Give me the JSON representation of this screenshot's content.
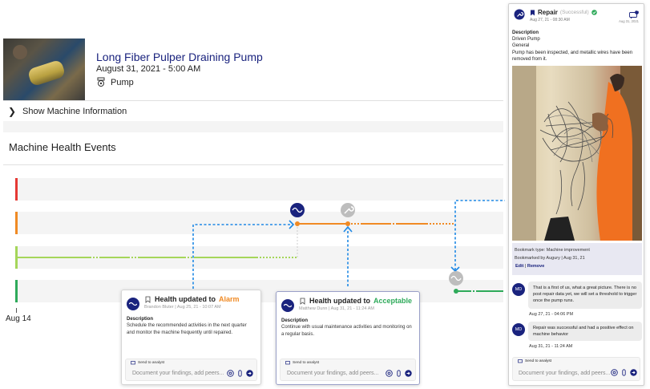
{
  "machine": {
    "name": "Long Fiber Pulper Draining Pump",
    "datetime": "August 31, 2021 - 5:00 AM",
    "type": "Pump"
  },
  "info_toggle": {
    "label": "Show Machine Information",
    "icon": "chevron-right-icon"
  },
  "section_title": "Machine Health Events",
  "axis": {
    "label": "Aug 14"
  },
  "lanes": [
    {
      "color": "#e53935"
    },
    {
      "color": "#f08a24"
    },
    {
      "color": "#a5d65a"
    },
    {
      "color": "#2eaa5a"
    }
  ],
  "cards": {
    "alarm": {
      "prefix": "Health updated to",
      "status": "Alarm",
      "meta": "Brandon Bluter | Aug 25, 21 - 10:07 AM",
      "desc_label": "Description",
      "desc": "Schedule the recommended activities in the next quarter and monitor the machine frequently until repaired.",
      "send_label": "Send to analyst",
      "placeholder": "Document your findings, add peers..."
    },
    "acceptable": {
      "prefix": "Health updated to",
      "status": "Acceptable",
      "meta": "Matthew Dunn | Aug 31, 21 - 11:24 AM",
      "desc_label": "Description",
      "desc": "Continue with usual maintenance activities and monitoring on a regular basis.",
      "send_label": "Send to analyst",
      "placeholder": "Document your findings, add peers..."
    }
  },
  "repair_panel": {
    "title": "Repair",
    "status": "(Successful)",
    "date": "Aug 27, 21 - 08:30 AM",
    "msg_badge": "1",
    "msg_date": "Aug 31, 2021",
    "desc_label": "Description",
    "desc_lines": [
      "Driven Pump",
      "General",
      "Pump has been inspected, and metallic wires have been removed from it."
    ],
    "bookmark_type": "Bookmark type: Machine improvement",
    "bookmarked_by": "Bookmarked by Augury | Aug 31, 21",
    "edit_label": "Edit",
    "remove_label": "Remove",
    "messages": [
      {
        "avatar": "MD",
        "text": "That is a first of us, what a great picture. There is no post repair data yet, we will set a threshold to trigger once the pump runs.",
        "time": "Aug 27, 21 - 04:06 PM"
      },
      {
        "avatar": "MD",
        "text": "Repair was successful and had a positive effect on machine behavior",
        "time": "Aug 31, 21 - 11:24 AM"
      }
    ],
    "send_label": "Send to analyst",
    "placeholder": "Document your findings, add peers..."
  },
  "colors": {
    "navy": "#1a237e",
    "dashed_link": "#1e88e5",
    "alarm": "#f08a24",
    "acceptable": "#2eaa5a"
  }
}
